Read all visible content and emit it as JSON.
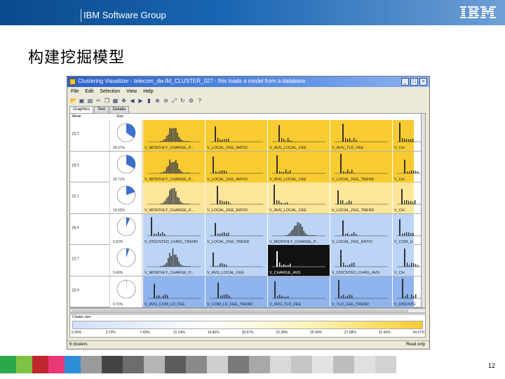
{
  "header": {
    "group": "IBM Software Group",
    "logo_text": "IBM"
  },
  "slide": {
    "title": "构建挖掘模型",
    "page_number": "12"
  },
  "app": {
    "window_title": "Clustering Visualizer - telecom_dw.IM_CLUSTER_027 - this loads a model from a database",
    "menus": [
      "File",
      "Edit",
      "Selection",
      "View",
      "Help"
    ],
    "toolbar_icons": [
      "open-icon",
      "save-icon",
      "print-icon",
      "cut-icon",
      "copy-icon",
      "paste-icon",
      "move-icon",
      "back-icon",
      "forward-icon",
      "chart-icon",
      "zoom-in-icon",
      "zoom-out-icon",
      "fit-icon",
      "refresh-icon",
      "settings-icon",
      "help-icon"
    ],
    "tabs": [
      "Graphics",
      "Text",
      "Details"
    ],
    "columns": [
      "Mean",
      "Size"
    ],
    "rows": [
      {
        "id": "[3] 2",
        "pct": "34.57%",
        "share": 0.3457,
        "band": "yellow",
        "cells": [
          {
            "label": "V_MONTHLY_CHARGE_P...",
            "kind": "hist"
          },
          {
            "label": "V_LOCAL_FEE_RATIO",
            "kind": "spike"
          },
          {
            "label": "V_AVG_LOCAL_FEE",
            "kind": "spike"
          },
          {
            "label": "V_AVG_TLD_FEE",
            "kind": "spike"
          },
          {
            "label": "V_CH",
            "kind": "spike"
          }
        ]
      },
      {
        "id": "[3] 5",
        "pct": "32.71%",
        "share": 0.3271,
        "band": "yellow",
        "cells": [
          {
            "label": "V_MONTHLY_CHARGE_P...",
            "kind": "hist"
          },
          {
            "label": "V_LOCAL_FEE_RATIO",
            "kind": "spike"
          },
          {
            "label": "V_AVG_LOCAL_FEE",
            "kind": "spike"
          },
          {
            "label": "V_LOCAL_FEE_TREND",
            "kind": "spike"
          },
          {
            "label": "V_CH",
            "kind": "spike"
          }
        ]
      },
      {
        "id": "[1] 1",
        "pct": "19.52%",
        "share": 0.1952,
        "band": "lightyellow",
        "cells": [
          {
            "label": "V_MONTHLY_CHARGE_P...",
            "kind": "hist"
          },
          {
            "label": "V_LOCAL_FEE_RATIO",
            "kind": "spike"
          },
          {
            "label": "V_AVG_LOCAL_FEE",
            "kind": "spike"
          },
          {
            "label": "V_LOCAL_FEE_TREND",
            "kind": "spike"
          },
          {
            "label": "V_CH",
            "kind": "spike"
          }
        ]
      },
      {
        "id": "[4] 6",
        "pct": "6.62%",
        "share": 0.0662,
        "band": "lightblue",
        "cells": [
          {
            "label": "V_DISCNTED_CHRG_TREND",
            "kind": "spike"
          },
          {
            "label": "V_LOCAL_FEE_TREND",
            "kind": "spike"
          },
          {
            "label": "V_MONTHLY_CHARGE_P...",
            "kind": "hist"
          },
          {
            "label": "V_LOCAL_FEE_RATIO",
            "kind": "spike"
          },
          {
            "label": "V_COM_U",
            "kind": "spike"
          }
        ]
      },
      {
        "id": "[1] 7",
        "pct": "5.40%",
        "share": 0.054,
        "band": "lightblue",
        "cells": [
          {
            "label": "V_MONTHLY_CHARGE_P...",
            "kind": "hist"
          },
          {
            "label": "V_AVG_LOCAL_FEE",
            "kind": "spike"
          },
          {
            "label": "V_CHARGE_AVG",
            "kind": "spike",
            "dark": true
          },
          {
            "label": "V_DISCNTED_CHRG_AVG",
            "kind": "spike"
          },
          {
            "label": "V_CH",
            "kind": "spike"
          }
        ]
      },
      {
        "id": "[3] 8",
        "pct": "0.72%",
        "share": 0.0072,
        "band": "blue",
        "cells": [
          {
            "label": "V_AVG_COM_LD_FEE",
            "kind": "spike"
          },
          {
            "label": "V_COM_LD_FEE_TREND",
            "kind": "spike"
          },
          {
            "label": "V_AVG_TLD_FEE",
            "kind": "spike"
          },
          {
            "label": "V_TLD_FEE_TREND",
            "kind": "spike"
          },
          {
            "label": "V_DISCNTE",
            "kind": "spike"
          }
        ]
      }
    ],
    "cluster_size_label": "Cluster size",
    "cluster_ticks": [
      "0.00%",
      "3.72%",
      "7.43%",
      "11.14%",
      "14.86%",
      "18.57%",
      "22.28%",
      "25.99%",
      "27.08%",
      "31.43%",
      "34.57%"
    ],
    "status_left": "6 clusters",
    "status_right": "Read only"
  },
  "colors": {
    "yellow": "#f8cc30",
    "lightyellow": "#fbe69a",
    "lightblue": "#bcd4f6",
    "blue": "#8fb4ee",
    "dark": "#111111",
    "pie": "#3a6fd0"
  },
  "footer_colors": [
    "#2aa84a",
    "#7fc241",
    "#c0262d",
    "#e83878",
    "#2e8fd6",
    "#9a9a9a",
    "#444444",
    "#6d6d6d",
    "#b5b5b5",
    "#5c5c5c",
    "#8a8a8a",
    "#cfcfcf",
    "#7a7a7a",
    "#a8a8a8",
    "#d9d9d9",
    "#c6c6c6",
    "#e3e3e3",
    "#bdbdbd",
    "#e0e0e0",
    "#d2d2d2"
  ]
}
